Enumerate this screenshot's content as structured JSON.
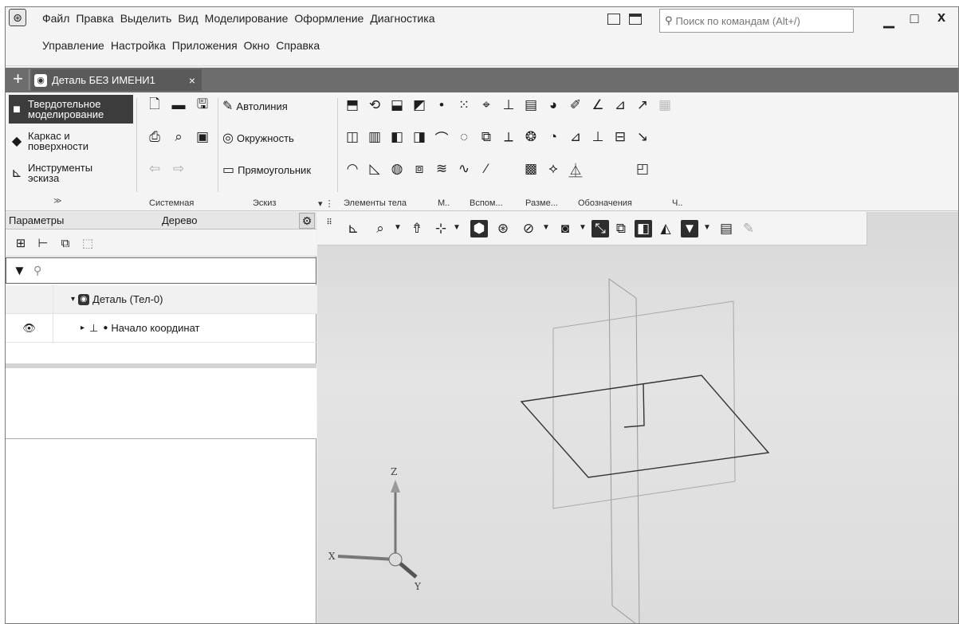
{
  "menu": {
    "row1": [
      "Файл",
      "Правка",
      "Выделить",
      "Вид",
      "Моделирование",
      "Оформление",
      "Диагностика"
    ],
    "row2": [
      "Управление",
      "Настройка",
      "Приложения",
      "Окно",
      "Справка"
    ]
  },
  "search": {
    "placeholder": "Поиск по командам (Alt+/)"
  },
  "tab": {
    "plus": "+",
    "title": "Деталь БЕЗ ИМЕНИ1",
    "close": "×"
  },
  "modes": [
    {
      "label": "Твердотельное моделирование",
      "line1": "Твердотельное",
      "line2": "моделирование",
      "icon": "solid-icon"
    },
    {
      "label": "Каркас и поверхности",
      "line1": "Каркас и",
      "line2": "поверхности",
      "icon": "surface-icon"
    },
    {
      "label": "Инструменты эскиза",
      "line1": "Инструменты",
      "line2": "эскиза",
      "icon": "sketch-tools-icon"
    }
  ],
  "sketch_commands": {
    "autoline": "Автолиния",
    "circle": "Окружность",
    "rectangle": "Прямоугольник"
  },
  "groups": [
    "Системная",
    "Эскиз",
    "Элементы тела",
    "М..",
    "Вспом...",
    "Разме...",
    "Обозначения",
    "Ч.."
  ],
  "panel": {
    "tab_params": "Параметры",
    "tab_tree": "Дерево",
    "search_placeholder": "",
    "tree": [
      {
        "label": "Деталь (Тел-0)",
        "expander": "▾"
      },
      {
        "label": "Начало координат",
        "expander": "▸"
      }
    ]
  },
  "axes": {
    "x": "X",
    "y": "Y",
    "z": "Z"
  },
  "colors": {
    "active_mode": "#3c3c3c",
    "tab_strip": "#6d6d6d",
    "viewport_bg": "#dcdcdc"
  }
}
